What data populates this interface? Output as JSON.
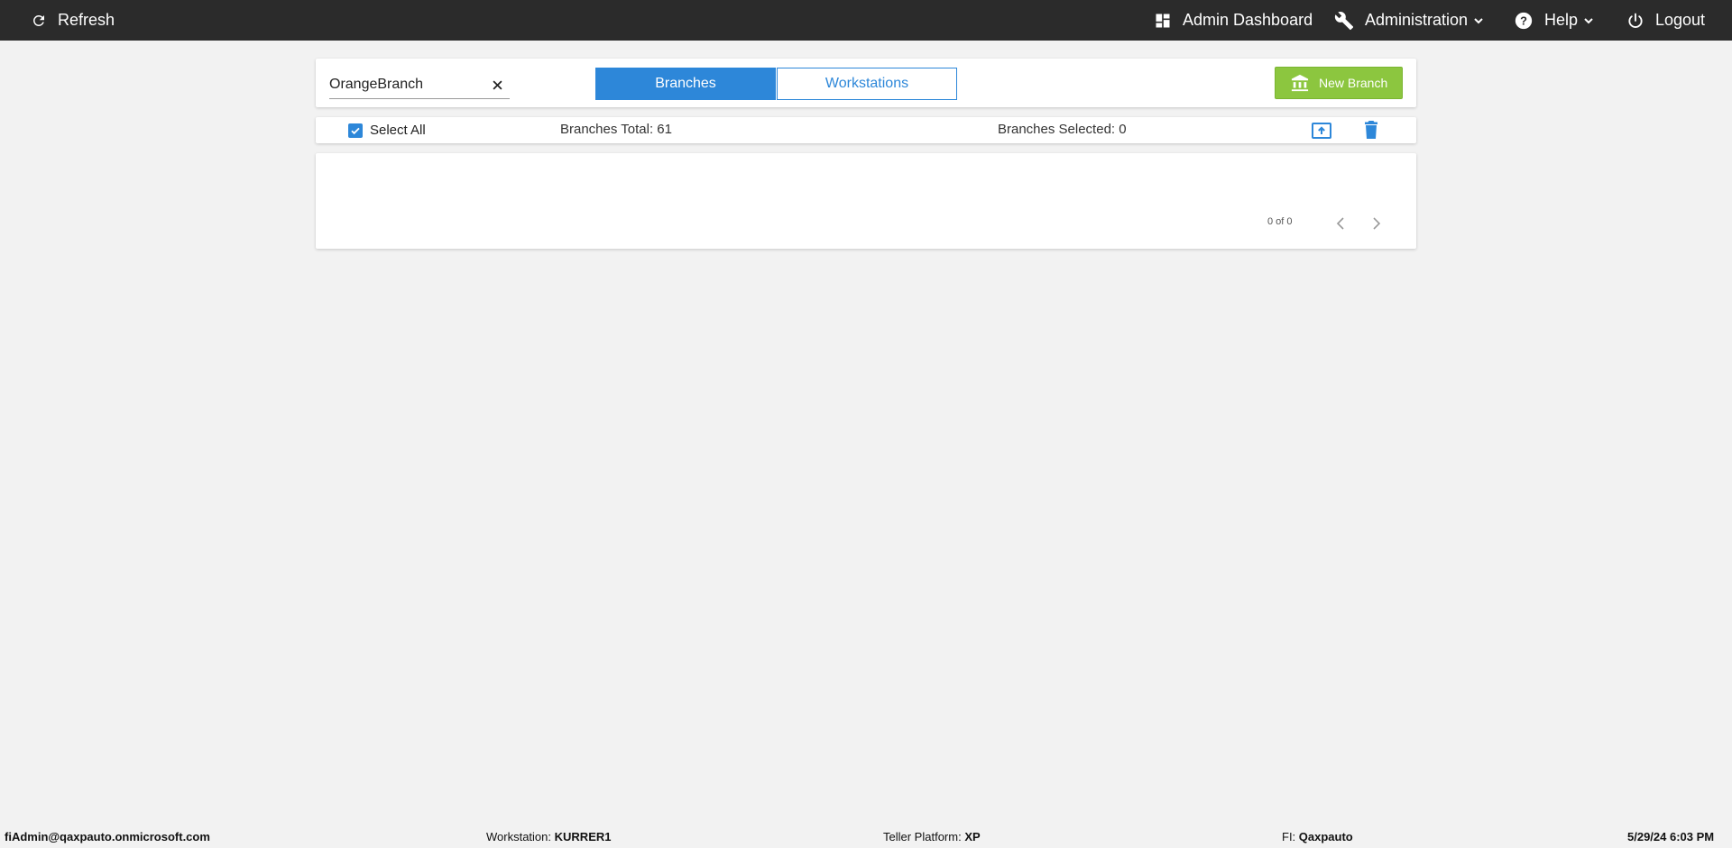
{
  "nav": {
    "refresh": "Refresh",
    "admin_dashboard": "Admin Dashboard",
    "administration": "Administration",
    "help": "Help",
    "logout": "Logout"
  },
  "search": {
    "value": "OrangeBranch",
    "placeholder": ""
  },
  "tabs": [
    {
      "label": "Branches",
      "active": true
    },
    {
      "label": "Workstations",
      "active": false
    }
  ],
  "new_branch_label": "New Branch",
  "toolbar": {
    "select_all": "Select All",
    "select_all_checked": true,
    "total": "Branches Total: 61",
    "selected": "Branches Selected: 0"
  },
  "pager": {
    "text": "0 of 0"
  },
  "footer": {
    "user": "fiAdmin@qaxpauto.onmicrosoft.com",
    "workstation_label": "Workstation:",
    "workstation": "KURRER1",
    "platform_label": "Teller Platform:",
    "platform": "XP",
    "fi_label": "FI:",
    "fi": "Qaxpauto",
    "datetime": "5/29/24 6:03 PM"
  },
  "colors": {
    "topbar": "#2b2b2b",
    "primary": "#2d87d9",
    "success": "#8cc63f",
    "background": "#f2f2f2"
  }
}
